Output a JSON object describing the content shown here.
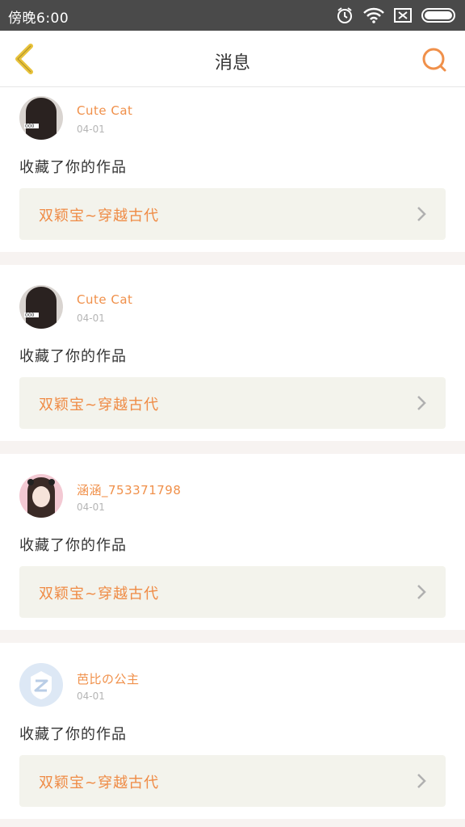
{
  "status_bar": {
    "time": "傍晚6:00",
    "icons": [
      "alarm-icon",
      "wifi-icon",
      "sim-icon",
      "battery-icon"
    ]
  },
  "header": {
    "title": "消息",
    "back_icon": "chevron-left-icon",
    "search_icon": "search-icon"
  },
  "colors": {
    "accent": "#f0904a",
    "back_icon": "#e8c23a",
    "link_bg": "#f3f3ec",
    "separator": "#f7f3f1",
    "status_bar": "#4a4a4a"
  },
  "messages": [
    {
      "username": "Cute Cat",
      "date": "04-01",
      "action": "收藏了你的作品",
      "work_title": "双颖宝~穿越古代",
      "avatar": "dark-hair-avatar"
    },
    {
      "username": "Cute Cat",
      "date": "04-01",
      "action": "收藏了你的作品",
      "work_title": "双颖宝~穿越古代",
      "avatar": "dark-hair-avatar"
    },
    {
      "username": "涵涵_753371798",
      "date": "04-01",
      "action": "收藏了你的作品",
      "work_title": "双颖宝~穿越古代",
      "avatar": "girl-photo-avatar"
    },
    {
      "username": "芭比の公主",
      "date": "04-01",
      "action": "收藏了你的作品",
      "work_title": "双颖宝~穿越古代",
      "avatar": "default-z-avatar"
    }
  ]
}
